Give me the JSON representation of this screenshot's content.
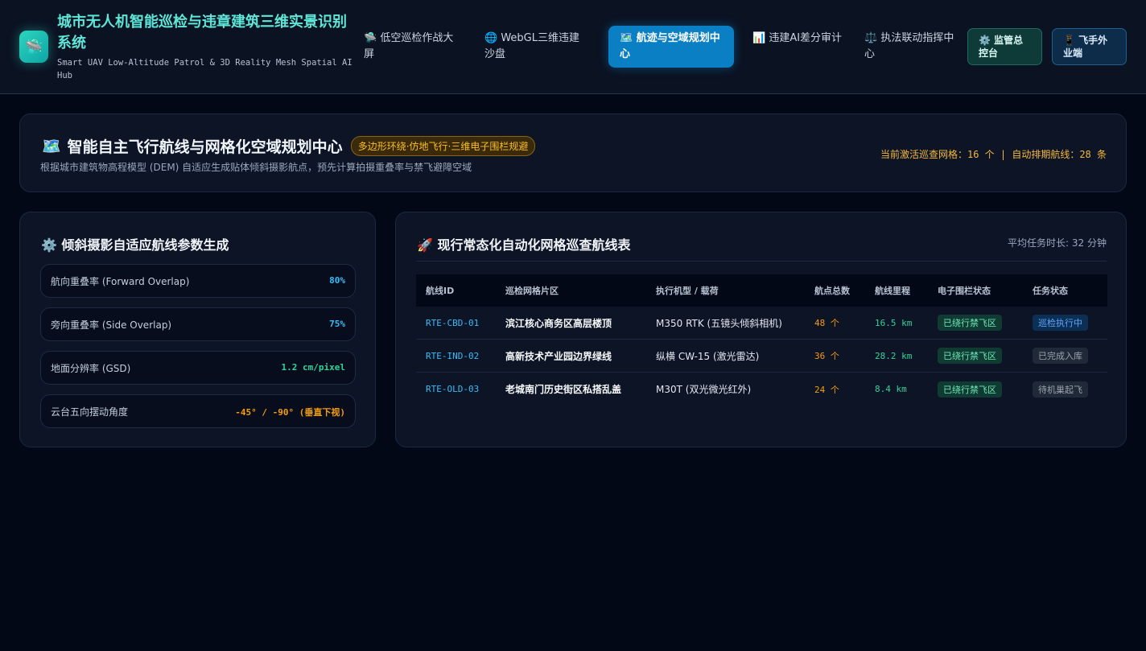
{
  "header": {
    "logo_glyph": "🛸",
    "title": "城市无人机智能巡检与违章建筑三维实景识别系统",
    "subtitle": "Smart UAV Low-Altitude Patrol & 3D Reality Mesh Spatial AI Hub",
    "nav": [
      {
        "icon": "🛸",
        "label": "低空巡检作战大屏"
      },
      {
        "icon": "🌐",
        "label": "WebGL三维违建沙盘"
      },
      {
        "icon": "🗺️",
        "label": "航迹与空域规划中心",
        "active": true
      },
      {
        "icon": "📊",
        "label": "违建AI差分审计"
      },
      {
        "icon": "⚖️",
        "label": "执法联动指挥中心"
      }
    ],
    "buttons": [
      {
        "icon": "⚙️",
        "label": "监管总控台"
      },
      {
        "icon": "📱",
        "label": "飞手外业端"
      }
    ]
  },
  "hero": {
    "icon": "🗺️",
    "title": "智能自主飞行航线与网格化空域规划中心",
    "badge": "多边形环绕·仿地飞行·三维电子围栏规避",
    "description": "根据城市建筑物高程模型 (DEM) 自适应生成贴体倾斜摄影航点，预先计算拍摄重叠率与禁飞避障空域",
    "stats": "当前激活巡查网格：16 个 | 自动排期航线：28 条"
  },
  "params": {
    "icon": "⚙️",
    "title": "倾斜摄影自适应航线参数生成",
    "rows": [
      {
        "label": "航向重叠率 (Forward Overlap)",
        "value": "80%"
      },
      {
        "label": "旁向重叠率 (Side Overlap)",
        "value": "75%"
      },
      {
        "label": "地面分辨率 (GSD)",
        "value": "1.2 cm/pixel"
      },
      {
        "label": "云台五向摆动角度",
        "value": "-45° / -90° (垂直下视)"
      }
    ]
  },
  "routes": {
    "icon": "🚀",
    "title": "现行常态化自动化网格巡查航线表",
    "avg": "平均任务时长: 32 分钟",
    "columns": [
      "航线ID",
      "巡检网格片区",
      "执行机型 / 载荷",
      "航点总数",
      "航线里程",
      "电子围栏状态",
      "任务状态"
    ],
    "rows": [
      {
        "id": "RTE-CBD-01",
        "zone": "滨江核心商务区高层楼顶",
        "model": "M350 RTK (五镜头倾斜相机)",
        "points": "48 个",
        "distance": "16.5 km",
        "fence": "已绕行禁飞区",
        "status": "巡检执行中",
        "status_type": "run"
      },
      {
        "id": "RTE-IND-02",
        "zone": "高新技术产业园边界绿线",
        "model": "纵横 CW-15 (激光雷达)",
        "points": "36 个",
        "distance": "28.2 km",
        "fence": "已绕行禁飞区",
        "status": "已完成入库",
        "status_type": "done"
      },
      {
        "id": "RTE-OLD-03",
        "zone": "老城南门历史街区私搭乱盖",
        "model": "M30T (双光微光红外)",
        "points": "24 个",
        "distance": "8.4 km",
        "fence": "已绕行禁飞区",
        "status": "待机巢起飞",
        "status_type": "done"
      }
    ]
  }
}
